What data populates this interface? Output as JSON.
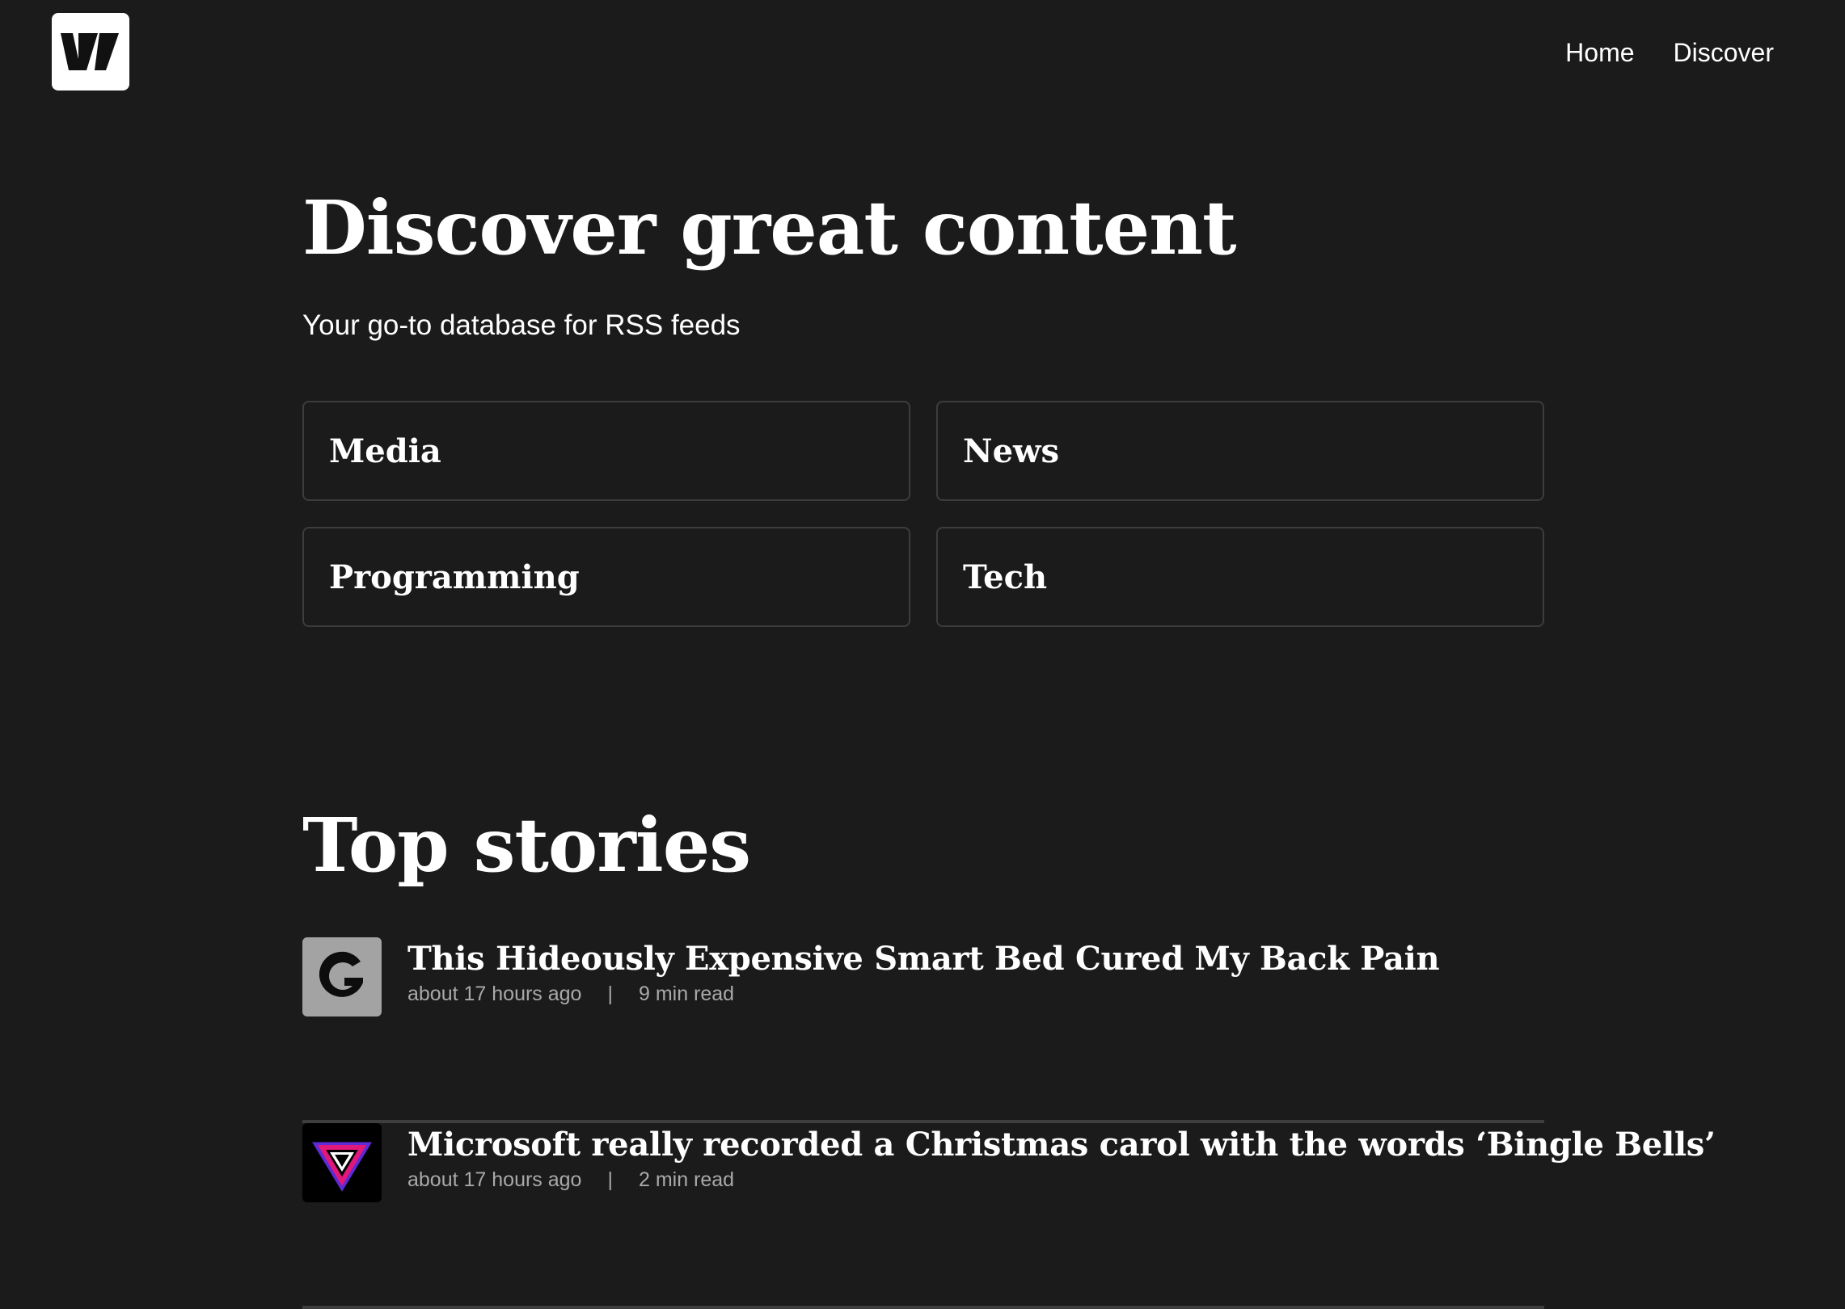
{
  "header": {
    "logo_icon": "brand-logo-icon",
    "nav": [
      {
        "label": "Home"
      },
      {
        "label": "Discover"
      }
    ]
  },
  "hero": {
    "title": "Discover great content",
    "subtitle": "Your go-to database for RSS feeds"
  },
  "categories": [
    {
      "label": "Media"
    },
    {
      "label": "News"
    },
    {
      "label": "Programming"
    },
    {
      "label": "Tech"
    }
  ],
  "top_stories": {
    "title": "Top stories",
    "items": [
      {
        "title": "This Hideously Expensive Smart Bed Cured My Back Pain",
        "time": "about 17 hours ago",
        "separator": "|",
        "read_time": "9 min read",
        "icon": "gizmodo-g-icon"
      },
      {
        "title": "Microsoft really recorded a Christmas carol with the words ‘Bingle Bells’",
        "time": "about 17 hours ago",
        "separator": "|",
        "read_time": "2 min read",
        "icon": "verge-triangle-icon"
      }
    ]
  },
  "colors": {
    "background": "#1b1b1b",
    "text": "#ffffff",
    "muted_text": "#a9a9a9",
    "border": "#3d3d3d",
    "divider": "#3e3e3e"
  }
}
